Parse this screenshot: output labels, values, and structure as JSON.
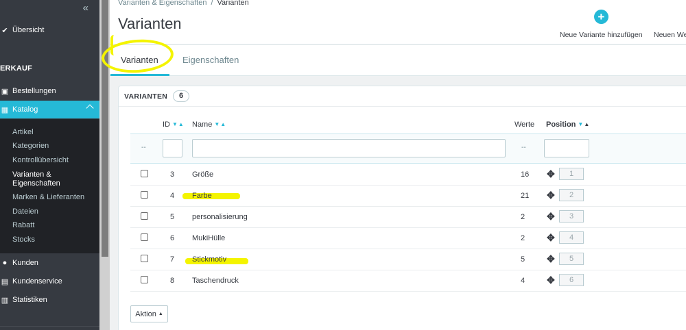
{
  "sidebar": {
    "collapse_icon": "double-chevron-left-icon",
    "overview": "Übersicht",
    "section_sell": "ERKAUF",
    "orders": "Bestellungen",
    "catalog": "Katalog",
    "catalog_sub": [
      "Artikel",
      "Kategorien",
      "Kontrollübersicht",
      "Varianten &",
      "Eigenschaften",
      "Marken & Lieferanten",
      "Dateien",
      "Rabatt",
      "Stocks"
    ],
    "customers": "Kunden",
    "customer_service": "Kundenservice",
    "stats": "Statistiken"
  },
  "header": {
    "breadcrumb_parent": "Varianten & Eigenschaften",
    "breadcrumb_sep": "/",
    "breadcrumb_current": "Varianten",
    "title": "Varianten",
    "btn_new_variant": "Neue Variante hinzufügen",
    "btn_new_value": "Neuen We"
  },
  "tabs": [
    "Varianten",
    "Eigenschaften"
  ],
  "panel": {
    "title": "VARIANTEN",
    "count": "6"
  },
  "table": {
    "headers": {
      "id": "ID",
      "name": "Name",
      "values": "Werte",
      "position": "Position"
    },
    "filter_dash": "--",
    "rows": [
      {
        "id": "3",
        "name": "Größe",
        "values": "16",
        "position": "1"
      },
      {
        "id": "4",
        "name": "Farbe",
        "values": "21",
        "position": "2"
      },
      {
        "id": "5",
        "name": "personalisierung",
        "values": "2",
        "position": "3"
      },
      {
        "id": "6",
        "name": "MukiHülle",
        "values": "2",
        "position": "4"
      },
      {
        "id": "7",
        "name": "Stickmotiv",
        "values": "5",
        "position": "5"
      },
      {
        "id": "8",
        "name": "Taschendruck",
        "values": "4",
        "position": "6"
      }
    ]
  },
  "bulk_action": "Aktion",
  "colors": {
    "accent": "#25b9d7",
    "sidebar_bg": "#363a41",
    "highlight": "#f4f400"
  }
}
